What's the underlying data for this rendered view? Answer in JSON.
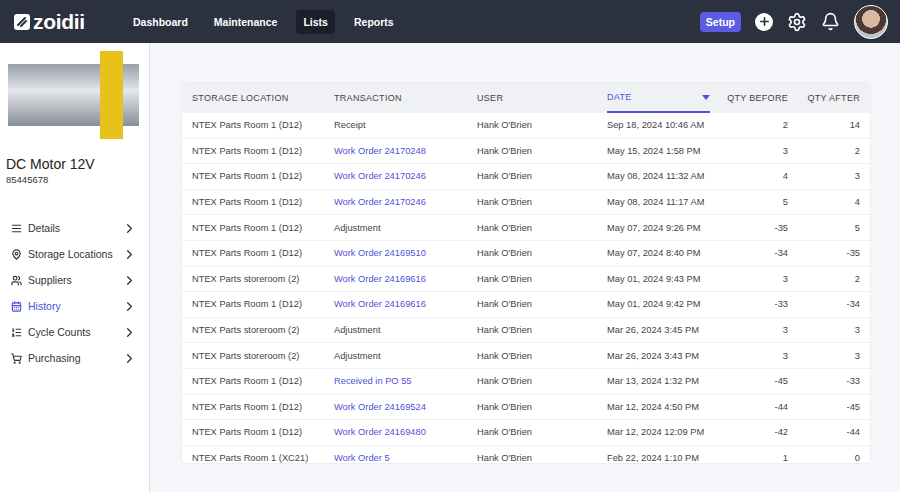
{
  "topbar": {
    "logo": "zoidii",
    "nav": [
      {
        "label": "Dashboard",
        "selected": false
      },
      {
        "label": "Maintenance",
        "selected": false
      },
      {
        "label": "Lists",
        "selected": true
      },
      {
        "label": "Reports",
        "selected": false
      }
    ],
    "setup": "Setup"
  },
  "part": {
    "name": "DC Motor 12V",
    "number": "85445678"
  },
  "sidebar": {
    "items": [
      {
        "label": "Details",
        "icon": "details",
        "selected": false
      },
      {
        "label": "Storage Locations",
        "icon": "location",
        "selected": false
      },
      {
        "label": "Suppliers",
        "icon": "suppliers",
        "selected": false
      },
      {
        "label": "History",
        "icon": "history",
        "selected": true
      },
      {
        "label": "Cycle Counts",
        "icon": "counts",
        "selected": false
      },
      {
        "label": "Purchasing",
        "icon": "purchasing",
        "selected": false
      }
    ]
  },
  "table": {
    "columns": [
      {
        "label": "STORAGE LOCATION",
        "align": "left",
        "sorted": false
      },
      {
        "label": "TRANSACTION",
        "align": "left",
        "sorted": false
      },
      {
        "label": "USER",
        "align": "left",
        "sorted": false
      },
      {
        "label": "DATE",
        "align": "left",
        "sorted": true
      },
      {
        "label": "QTY BEFORE",
        "align": "right",
        "sorted": false
      },
      {
        "label": "QTY AFTER",
        "align": "right",
        "sorted": false
      }
    ],
    "rows": [
      {
        "location": "NTEX Parts Room 1 (D12)",
        "transaction": "Receipt",
        "link": false,
        "user": "Hank O'Brien",
        "date": "Sep 18, 2024 10:46 AM",
        "before": "2",
        "after": "14"
      },
      {
        "location": "NTEX Parts Room 1 (D12)",
        "transaction": "Work Order 24170248",
        "link": true,
        "user": "Hank O'Brien",
        "date": "May 15, 2024 1:58 PM",
        "before": "3",
        "after": "2"
      },
      {
        "location": "NTEX Parts Room 1 (D12)",
        "transaction": "Work Order 24170246",
        "link": true,
        "user": "Hank O'Brien",
        "date": "May 08, 2024 11:32 AM",
        "before": "4",
        "after": "3"
      },
      {
        "location": "NTEX Parts Room 1 (D12)",
        "transaction": "Work Order 24170246",
        "link": true,
        "user": "Hank O'Brien",
        "date": "May 08, 2024 11:17 AM",
        "before": "5",
        "after": "4"
      },
      {
        "location": "NTEX Parts Room 1 (D12)",
        "transaction": "Adjustment",
        "link": false,
        "user": "Hank O'Brien",
        "date": "May 07, 2024 9:26 PM",
        "before": "-35",
        "after": "5"
      },
      {
        "location": "NTEX Parts Room 1 (D12)",
        "transaction": "Work Order 24169510",
        "link": true,
        "user": "Hank O'Brien",
        "date": "May 07, 2024 8:40 PM",
        "before": "-34",
        "after": "-35"
      },
      {
        "location": "NTEX Parts storeroom (2)",
        "transaction": "Work Order 24169616",
        "link": true,
        "user": "Hank O'Brien",
        "date": "May 01, 2024 9:43 PM",
        "before": "3",
        "after": "2"
      },
      {
        "location": "NTEX Parts Room 1 (D12)",
        "transaction": "Work Order 24169616",
        "link": true,
        "user": "Hank O'Brien",
        "date": "May 01, 2024 9:42 PM",
        "before": "-33",
        "after": "-34"
      },
      {
        "location": "NTEX Parts storeroom (2)",
        "transaction": "Adjustment",
        "link": false,
        "user": "Hank O'Brien",
        "date": "Mar 26, 2024 3:45 PM",
        "before": "3",
        "after": "3"
      },
      {
        "location": "NTEX Parts storeroom (2)",
        "transaction": "Adjustment",
        "link": false,
        "user": "Hank O'Brien",
        "date": "Mar 26, 2024 3:43 PM",
        "before": "3",
        "after": "3"
      },
      {
        "location": "NTEX Parts Room 1 (D12)",
        "transaction": "Received in PO 55",
        "link": true,
        "user": "Hank O'Brien",
        "date": "Mar 13, 2024 1:32 PM",
        "before": "-45",
        "after": "-33"
      },
      {
        "location": "NTEX Parts Room 1 (D12)",
        "transaction": "Work Order 24169524",
        "link": true,
        "user": "Hank O'Brien",
        "date": "Mar 12, 2024 4:50 PM",
        "before": "-44",
        "after": "-45"
      },
      {
        "location": "NTEX Parts Room 1 (D12)",
        "transaction": "Work Order 24169480",
        "link": true,
        "user": "Hank O'Brien",
        "date": "Mar 12, 2024 12:09 PM",
        "before": "-42",
        "after": "-44"
      },
      {
        "location": "NTEX Parts Room 1 (XC21)",
        "transaction": "Work Order 5",
        "link": true,
        "user": "Hank O'Brien",
        "date": "Feb 22, 2024 1:10 PM",
        "before": "1",
        "after": "0"
      }
    ]
  }
}
